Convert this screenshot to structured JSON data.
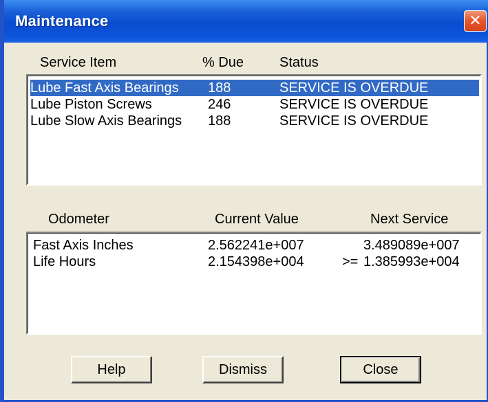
{
  "window": {
    "title": "Maintenance",
    "close_glyph": "✕"
  },
  "service_list": {
    "headers": [
      "Service Item",
      "% Due",
      "Status"
    ],
    "rows": [
      {
        "item": "Lube Fast Axis Bearings",
        "due": "188",
        "status": "SERVICE IS OVERDUE",
        "selected": true
      },
      {
        "item": "Lube Piston Screws",
        "due": "246",
        "status": "SERVICE IS OVERDUE",
        "selected": false
      },
      {
        "item": "Lube Slow Axis Bearings",
        "due": "188",
        "status": "SERVICE IS OVERDUE",
        "selected": false
      }
    ]
  },
  "odometer_list": {
    "headers": [
      "Odometer",
      "Current Value",
      "Next Service"
    ],
    "rows": [
      {
        "name": "Fast Axis Inches",
        "current": "2.562241e+007",
        "op": "",
        "next": "3.489089e+007"
      },
      {
        "name": "Life Hours",
        "current": "2.154398e+004",
        "op": ">=",
        "next": "1.385993e+004"
      }
    ]
  },
  "buttons": {
    "help": "Help",
    "dismiss": "Dismiss",
    "close": "Close"
  },
  "colors": {
    "selection": "#316ac5",
    "titlebar": "#0a4ccf",
    "dialog_bg": "#ece9d8"
  }
}
